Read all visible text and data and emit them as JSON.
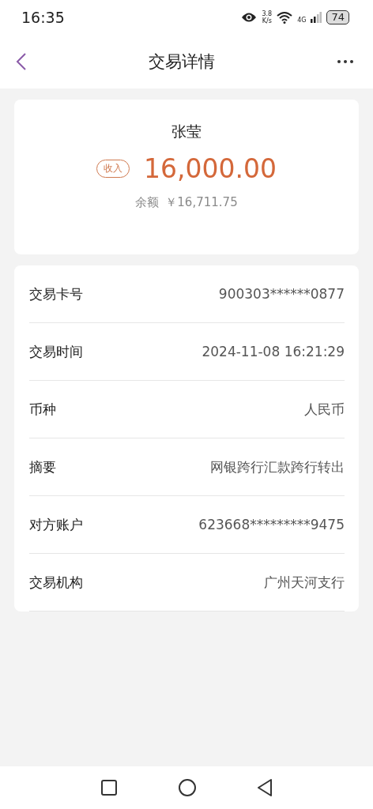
{
  "status_bar": {
    "time": "16:35",
    "speed_value": "3.8",
    "speed_unit": "K/s",
    "network": "4G",
    "battery": "74"
  },
  "header": {
    "title": "交易详情"
  },
  "summary": {
    "name": "张莹",
    "tag": "收入",
    "amount": "16,000.00",
    "balance_label": "余额",
    "balance": "￥16,711.75"
  },
  "details": [
    {
      "label": "交易卡号",
      "value": "900303******0877"
    },
    {
      "label": "交易时间",
      "value": "2024-11-08 16:21:29"
    },
    {
      "label": "币种",
      "value": "人民币"
    },
    {
      "label": "摘要",
      "value": "网银跨行汇款跨行转出"
    },
    {
      "label": "对方账户",
      "value": "623668*********9475"
    },
    {
      "label": "交易机构",
      "value": "广州天河支行"
    }
  ]
}
